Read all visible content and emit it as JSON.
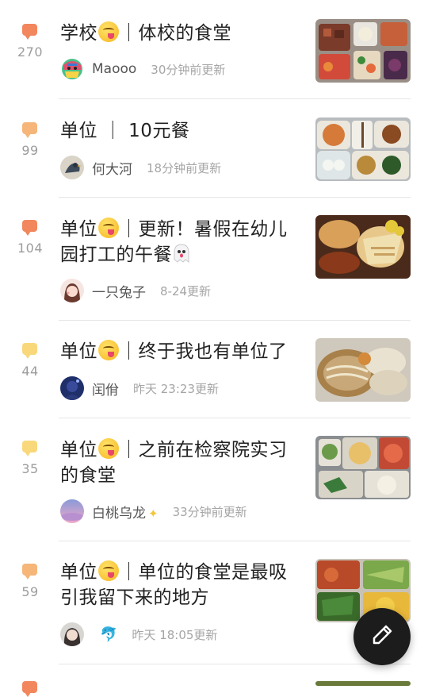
{
  "posts": [
    {
      "count": "270",
      "bubble_color": "#f2875d",
      "title_parts": [
        "学校",
        "｜体校的食堂"
      ],
      "author": "Maooo",
      "time": "30分钟前更新"
    },
    {
      "count": "99",
      "bubble_color": "#f6b67a",
      "title_parts": [
        "单位 ｜ 10元餐"
      ],
      "author": "何大河",
      "time": "18分钟前更新"
    },
    {
      "count": "104",
      "bubble_color": "#f2875d",
      "title_parts": [
        "单位",
        "｜更新！暑假在幼儿园打工的午餐"
      ],
      "author": "一只兔子",
      "time": "8-24更新"
    },
    {
      "count": "44",
      "bubble_color": "#f9d87b",
      "title_parts": [
        "单位",
        "｜终于我也有单位了"
      ],
      "author": "闰佾",
      "time": "昨天 23:23更新"
    },
    {
      "count": "35",
      "bubble_color": "#f9d87b",
      "title_parts": [
        "单位",
        "｜之前在检察院实习的食堂"
      ],
      "author": "白桃乌龙",
      "time": "33分钟前更新"
    },
    {
      "count": "59",
      "bubble_color": "#f6b67a",
      "title_parts": [
        "单位",
        "｜单位的食堂是最吸引我留下来的地方"
      ],
      "author": "",
      "time": "昨天 18:05更新"
    }
  ],
  "fab_icon": "pen-icon",
  "colors": {
    "divider": "#e6e6e6",
    "fab": "#1c1c1c"
  }
}
